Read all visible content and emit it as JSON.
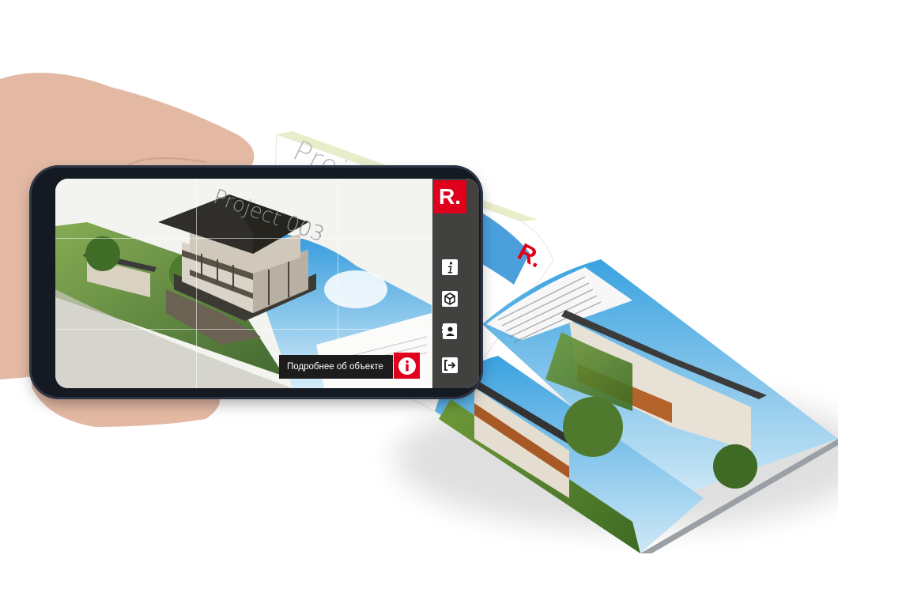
{
  "book": {
    "title": "Project"
  },
  "screen": {
    "overlay_title": "Project 003",
    "brand_logo": "R.",
    "sidebar": {
      "items": [
        {
          "icon": "info-icon"
        },
        {
          "icon": "cube-icon"
        },
        {
          "icon": "contacts-icon"
        },
        {
          "icon": "exit-icon"
        }
      ]
    },
    "tooltip_text": "Подробнее об объекте",
    "info_button_icon": "info-circle-icon"
  },
  "colors": {
    "accent": "#e0001b",
    "rail": "#1a1a1a",
    "phone_frame": "#151922"
  }
}
